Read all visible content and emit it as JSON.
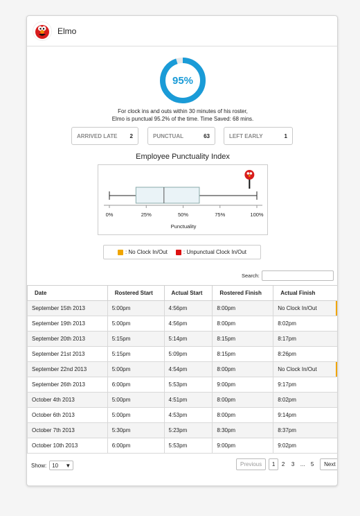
{
  "header": {
    "name": "Elmo",
    "avatar_icon": "elmo-avatar-icon"
  },
  "gauge": {
    "percent": 95,
    "label": "95%",
    "color": "#1a9bd7"
  },
  "summary": {
    "line1": "For clock ins and outs within 30 minutes of his roster,",
    "line2": "Elmo is punctual 95.2% of the time. Time Saved: 68 mins."
  },
  "stats": [
    {
      "label": "ARRIVED LATE",
      "value": "2"
    },
    {
      "label": "PUNCTUAL",
      "value": "63"
    },
    {
      "label": "LEFT EARLY",
      "value": "1"
    }
  ],
  "chart_data": {
    "type": "boxplot",
    "title": "Employee Punctuality Index",
    "xlabel": "Punctuality",
    "tick_labels": [
      "0%",
      "25%",
      "50%",
      "75%",
      "100%"
    ],
    "xlim": [
      0,
      100
    ],
    "box": {
      "min": 0,
      "q1": 18,
      "median": 37,
      "q3": 61,
      "max": 100
    },
    "marker": {
      "value": 95,
      "icon": "elmo-marker-icon"
    }
  },
  "legend": [
    {
      "label": ": No Clock In/Out",
      "color": "#f0a500"
    },
    {
      "label": ": Unpunctual Clock In/Out",
      "color": "#dd1111"
    }
  ],
  "search": {
    "label": "Search:",
    "value": ""
  },
  "table": {
    "columns": [
      "Date",
      "Rostered Start",
      "Actual Start",
      "Rostered Finish",
      "Actual Finish"
    ],
    "rows": [
      {
        "cells": [
          "September 15th 2013",
          "5:00pm",
          "4:56pm",
          "8:00pm",
          "No Clock In/Out"
        ],
        "flag": true
      },
      {
        "cells": [
          "September 19th 2013",
          "5:00pm",
          "4:56pm",
          "8:00pm",
          "8:02pm"
        ],
        "flag": false
      },
      {
        "cells": [
          "September 20th 2013",
          "5:15pm",
          "5:14pm",
          "8:15pm",
          "8:17pm"
        ],
        "flag": false
      },
      {
        "cells": [
          "September 21st 2013",
          "5:15pm",
          "5:09pm",
          "8:15pm",
          "8:26pm"
        ],
        "flag": false
      },
      {
        "cells": [
          "September 22nd 2013",
          "5:00pm",
          "4:54pm",
          "8:00pm",
          "No Clock In/Out"
        ],
        "flag": true
      },
      {
        "cells": [
          "September 26th 2013",
          "6:00pm",
          "5:53pm",
          "9:00pm",
          "9:17pm"
        ],
        "flag": false
      },
      {
        "cells": [
          "October 4th 2013",
          "5:00pm",
          "4:51pm",
          "8:00pm",
          "8:02pm"
        ],
        "flag": false
      },
      {
        "cells": [
          "October 6th 2013",
          "5:00pm",
          "4:53pm",
          "8:00pm",
          "9:14pm"
        ],
        "flag": false
      },
      {
        "cells": [
          "October 7th 2013",
          "5:30pm",
          "5:23pm",
          "8:30pm",
          "8:37pm"
        ],
        "flag": false
      },
      {
        "cells": [
          "October 10th 2013",
          "6:00pm",
          "5:53pm",
          "9:00pm",
          "9:02pm"
        ],
        "flag": false
      }
    ]
  },
  "show": {
    "label": "Show:",
    "value": "10"
  },
  "pagination": {
    "previous": "Previous",
    "pages": [
      "1",
      "2",
      "3",
      "...",
      "5"
    ],
    "active": "1",
    "next": "Next"
  }
}
